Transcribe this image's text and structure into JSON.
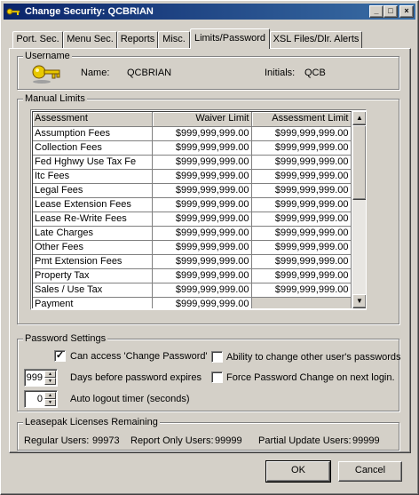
{
  "window": {
    "title": "Change Security: QCBRIAN"
  },
  "titlebar_buttons": {
    "minimize": "_",
    "maximize": "□",
    "close": "×"
  },
  "tabs": [
    {
      "label": "Port. Sec."
    },
    {
      "label": "Menu Sec."
    },
    {
      "label": "Reports"
    },
    {
      "label": "Misc."
    },
    {
      "label": "Limits/Password"
    },
    {
      "label": "XSL Files/Dlr. Alerts"
    }
  ],
  "active_tab": "Limits/Password",
  "username": {
    "legend": "Username",
    "icon": "key-icon",
    "name_label": "Name:",
    "name_value": "QCBRIAN",
    "initials_label": "Initials:",
    "initials_value": "QCB"
  },
  "manual_limits": {
    "legend": "Manual Limits",
    "columns": [
      "Assessment",
      "Waiver Limit",
      "Assessment Limit"
    ],
    "rows": [
      {
        "assessment": "Assumption Fees",
        "waiver": "$999,999,999.00",
        "limit": "$999,999,999.00"
      },
      {
        "assessment": "Collection Fees",
        "waiver": "$999,999,999.00",
        "limit": "$999,999,999.00"
      },
      {
        "assessment": "Fed Hghwy Use Tax Fe",
        "waiver": "$999,999,999.00",
        "limit": "$999,999,999.00"
      },
      {
        "assessment": "Itc Fees",
        "waiver": "$999,999,999.00",
        "limit": "$999,999,999.00"
      },
      {
        "assessment": "Legal Fees",
        "waiver": "$999,999,999.00",
        "limit": "$999,999,999.00"
      },
      {
        "assessment": "Lease Extension Fees",
        "waiver": "$999,999,999.00",
        "limit": "$999,999,999.00"
      },
      {
        "assessment": "Lease Re-Write Fees",
        "waiver": "$999,999,999.00",
        "limit": "$999,999,999.00"
      },
      {
        "assessment": "Late Charges",
        "waiver": "$999,999,999.00",
        "limit": "$999,999,999.00"
      },
      {
        "assessment": "Other Fees",
        "waiver": "$999,999,999.00",
        "limit": "$999,999,999.00"
      },
      {
        "assessment": "Pmt Extension Fees",
        "waiver": "$999,999,999.00",
        "limit": "$999,999,999.00"
      },
      {
        "assessment": "Property Tax",
        "waiver": "$999,999,999.00",
        "limit": "$999,999,999.00"
      },
      {
        "assessment": "Sales / Use Tax",
        "waiver": "$999,999,999.00",
        "limit": "$999,999,999.00"
      },
      {
        "assessment": "Payment",
        "waiver": "$999,999,999.00",
        "limit": ""
      }
    ],
    "scroll_up": "▲",
    "scroll_down": "▼"
  },
  "password_settings": {
    "legend": "Password Settings",
    "can_access_change_password": {
      "label": "Can access 'Change Password'",
      "checked": true
    },
    "ability_change_others": {
      "label": "Ability to change other user's passwords",
      "checked": false
    },
    "days_before_expire": {
      "value": "999",
      "label": "Days before password expires"
    },
    "force_change": {
      "label": "Force Password Change on next login.",
      "checked": false
    },
    "auto_logout": {
      "value": "0",
      "label": "Auto logout timer (seconds)"
    },
    "check_mark": "✓",
    "spin_up": "▲",
    "spin_down": "▼"
  },
  "licenses": {
    "legend": "Leasepak Licenses Remaining",
    "regular_label": "Regular Users:",
    "regular_value": "99973",
    "report_only_label": "Report Only Users:",
    "report_only_value": "99999",
    "partial_label": "Partial Update Users:",
    "partial_value": "99999"
  },
  "buttons": {
    "ok": "OK",
    "cancel": "Cancel"
  }
}
